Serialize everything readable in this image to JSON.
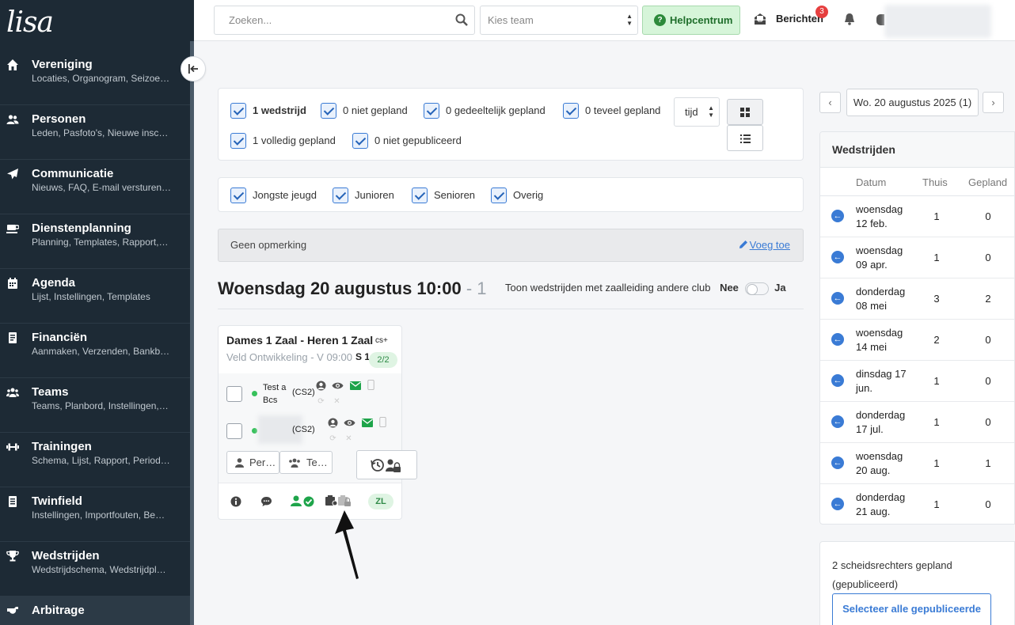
{
  "sidebar": {
    "logo": "lisa",
    "items": [
      {
        "title": "Vereniging",
        "subtitle": "Locaties, Organogram, Seizoe…",
        "icon": "home-icon"
      },
      {
        "title": "Personen",
        "subtitle": "Leden, Pasfoto's, Nieuwe insc…",
        "icon": "users-icon"
      },
      {
        "title": "Communicatie",
        "subtitle": "Nieuws, FAQ, E-mail versturen…",
        "icon": "paper-plane-icon"
      },
      {
        "title": "Dienstenplanning",
        "subtitle": "Planning, Templates, Rapport,…",
        "icon": "coffee-icon"
      },
      {
        "title": "Agenda",
        "subtitle": "Lijst, Instellingen, Templates",
        "icon": "calendar-icon"
      },
      {
        "title": "Financiën",
        "subtitle": "Aanmaken, Verzenden, Bankb…",
        "icon": "receipt-icon"
      },
      {
        "title": "Teams",
        "subtitle": "Teams, Planbord, Instellingen,…",
        "icon": "team-icon"
      },
      {
        "title": "Trainingen",
        "subtitle": "Schema, Lijst, Rapport, Period…",
        "icon": "dumbbell-icon"
      },
      {
        "title": "Twinfield",
        "subtitle": "Instellingen, Importfouten, Be…",
        "icon": "ledger-icon"
      },
      {
        "title": "Wedstrijden",
        "subtitle": "Wedstrijdschema, Wedstrijdpl…",
        "icon": "trophy-icon"
      },
      {
        "title": "Arbitrage",
        "subtitle": "",
        "icon": "whistle-icon"
      }
    ]
  },
  "topbar": {
    "search_placeholder": "Zoeken...",
    "team_placeholder": "Kies team",
    "help_label": "Helpcentrum",
    "messages_label": "Berichten",
    "messages_count": "3"
  },
  "filters": {
    "status": [
      {
        "label": "1 wedstrijd",
        "checked": true,
        "bold": true
      },
      {
        "label": "0 niet gepland",
        "checked": true
      },
      {
        "label": "0 gedeeltelijk gepland",
        "checked": true
      },
      {
        "label": "0 teveel gepland",
        "checked": true
      },
      {
        "label": "1 volledig gepland",
        "checked": true
      },
      {
        "label": "0 niet gepubliceerd",
        "checked": true
      }
    ],
    "sort_value": "tijd",
    "categories": [
      {
        "label": "Jongste jeugd",
        "checked": true
      },
      {
        "label": "Junioren",
        "checked": true
      },
      {
        "label": "Senioren",
        "checked": true
      },
      {
        "label": "Overig",
        "checked": true
      }
    ]
  },
  "remark": {
    "text": "Geen opmerking",
    "add_label": "Voeg toe"
  },
  "day": {
    "heading": "Woensdag 20 augustus 10:00",
    "separator": " - ",
    "count": "1",
    "toggle_label": "Toon wedstrijden met zaalleiding andere club",
    "toggle_no": "Nee",
    "toggle_yes": "Ja"
  },
  "match": {
    "title": "Dames 1 Zaal - Heren 1 Zaal",
    "cs_badge": "cs+",
    "location": "Veld Ontwikkeling - V 09:00",
    "field": "S 1",
    "assigned": "2/2",
    "referees": [
      {
        "name": "Test a Bcs",
        "code": "(CS2)"
      },
      {
        "name": "",
        "code": "(CS2)"
      }
    ],
    "btn_person": "Per…",
    "btn_team": "Te…",
    "footer_badge": "ZL"
  },
  "date_nav": {
    "current": "Wo. 20 augustus 2025 (1)",
    "prev": "‹",
    "next": "›"
  },
  "wedstrijden": {
    "title": "Wedstrijden",
    "headers": [
      "Datum",
      "Thuis",
      "Gepland"
    ],
    "rows": [
      {
        "date_l1": "woensdag",
        "date_l2": "12 feb.",
        "home": "1",
        "planned": "0"
      },
      {
        "date_l1": "woensdag",
        "date_l2": "09 apr.",
        "home": "1",
        "planned": "0"
      },
      {
        "date_l1": "donderdag",
        "date_l2": "08 mei",
        "home": "3",
        "planned": "2"
      },
      {
        "date_l1": "woensdag",
        "date_l2": "14 mei",
        "home": "2",
        "planned": "0"
      },
      {
        "date_l1": "dinsdag 17",
        "date_l2": "jun.",
        "home": "1",
        "planned": "0"
      },
      {
        "date_l1": "donderdag",
        "date_l2": "17 jul.",
        "home": "1",
        "planned": "0"
      },
      {
        "date_l1": "woensdag",
        "date_l2": "20 aug.",
        "home": "1",
        "planned": "1"
      },
      {
        "date_l1": "donderdag",
        "date_l2": "21 aug.",
        "home": "1",
        "planned": "0"
      }
    ]
  },
  "referee_summary": {
    "text": "2 scheidsrechters gepland (gepubliceerd)",
    "button": "Selecteer alle gepubliceerde"
  },
  "colors": {
    "sidebar": "#1d2a35",
    "accent": "#3a7bd5",
    "success": "#37c15b",
    "danger": "#e63f3f"
  }
}
